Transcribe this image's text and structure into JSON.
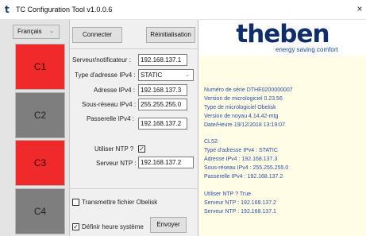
{
  "window": {
    "icon_glyph": "t",
    "title": "TC Configuration Tool v1.0.0.6",
    "close_glyph": "×"
  },
  "sidebar": {
    "language": "Français",
    "channels": [
      {
        "label": "C1",
        "state": "on",
        "color": "#f0292a"
      },
      {
        "label": "C2",
        "state": "off",
        "color": "#7e7e7e"
      },
      {
        "label": "C3",
        "state": "on",
        "color": "#f0292a"
      },
      {
        "label": "C4",
        "state": "off",
        "color": "#7e7e7e"
      }
    ]
  },
  "toolbar": {
    "connect_label": "Connecter",
    "reset_label": "Réinitialisation"
  },
  "form": {
    "server_label": "Serveur/notificateur :",
    "server_value": "192.168.137.1",
    "addr_type_label": "Type d'adresse IPv4 :",
    "addr_type_value": "STATIC",
    "ipv4_label": "Adresse IPv4 :",
    "ipv4_value": "192.168.137.3",
    "subnet_label": "Sous-réseau IPv4 :",
    "subnet_value": "255.255.255.0",
    "gateway_label": "Passerelle IPv4 :",
    "gateway_value": "192.168.137.2",
    "use_ntp_label": "Utiliser NTP ?",
    "use_ntp_checked": true,
    "ntp_server_label": "Serveur NTP :",
    "ntp_server_value": "192.168.137.2"
  },
  "transfer": {
    "send_obelisk_label": "Transmettre fichier Obelisk",
    "send_obelisk_checked": false,
    "set_time_label": "Définir heure système",
    "set_time_checked": true,
    "send_label": "Envoyer"
  },
  "brand": {
    "name": "theben",
    "tagline": "energy saving comfort",
    "color": "#0f2d69"
  },
  "info_lines": [
    "Numéro de série DTHE0200000007",
    "Version de micrologiciel 0.23.56",
    "Type de micrologiciel Obelisk",
    "Version de noyau 4.14.42-mtg",
    "Date/Heure 19/12/2018 13:19:07",
    "CL52:",
    "Type d'adresse IPv4 : STATIC",
    "Adresse IPv4 : 192.168.137.3",
    "Sous-réseau IPv4 : 255.255.255.0",
    "Passerelle IPv4 : 192.168.137.2",
    "Utiliser NTP ? True",
    "Serveur NTP : 192.168.137.2",
    "Serveur NTP : 192.168.137.1"
  ],
  "colors": {
    "active_channel": "#f0292a",
    "inactive_channel": "#7e7e7e",
    "info_text": "#2a50a8",
    "info_background": "#fffde5"
  }
}
